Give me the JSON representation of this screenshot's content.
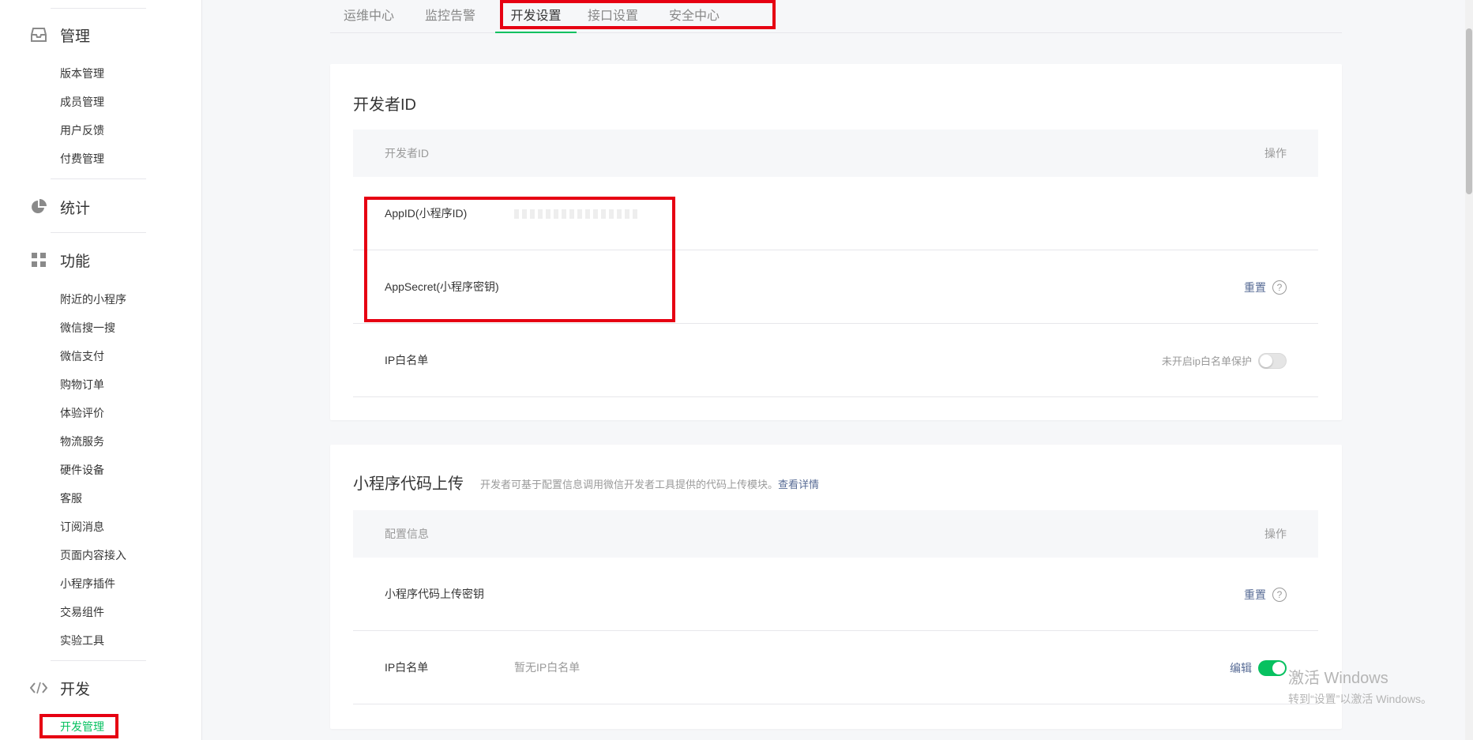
{
  "sidebar": {
    "sections": [
      {
        "label": "管理",
        "icon": "inbox-icon"
      },
      {
        "label": "统计",
        "icon": "pie-chart-icon"
      },
      {
        "label": "功能",
        "icon": "grid-icon"
      },
      {
        "label": "开发",
        "icon": "code-icon"
      }
    ],
    "manage_items": [
      "版本管理",
      "成员管理",
      "用户反馈",
      "付费管理"
    ],
    "feature_items": [
      "附近的小程序",
      "微信搜一搜",
      "微信支付",
      "购物订单",
      "体验评价",
      "物流服务",
      "硬件设备",
      "客服",
      "订阅消息",
      "页面内容接入",
      "小程序插件",
      "交易组件",
      "实验工具"
    ],
    "dev_items": [
      "开发管理"
    ]
  },
  "tabs": [
    "运维中心",
    "监控告警",
    "开发设置",
    "接口设置",
    "安全中心"
  ],
  "active_tab": "开发设置",
  "dev_id_card": {
    "title": "开发者ID",
    "col_name": "开发者ID",
    "col_ops": "操作",
    "rows": [
      {
        "name": "AppID(小程序ID)",
        "value": ""
      },
      {
        "name": "AppSecret(小程序密钥)",
        "op_link": "重置"
      },
      {
        "name": "IP白名单",
        "op_text": "未开启ip白名单保护"
      }
    ]
  },
  "upload_card": {
    "title": "小程序代码上传",
    "desc": "开发者可基于配置信息调用微信开发者工具提供的代码上传模块。",
    "desc_link": "查看详情",
    "col_name": "配置信息",
    "col_ops": "操作",
    "rows": [
      {
        "name": "小程序代码上传密钥",
        "op_link": "重置"
      },
      {
        "name": "IP白名单",
        "value": "暂无IP白名单",
        "op_link": "编辑"
      }
    ]
  },
  "watermark": {
    "line1": "激活 Windows",
    "line2": "转到“设置”以激活 Windows。"
  },
  "colors": {
    "accent": "#07c160",
    "link": "#576b95",
    "highlight": "#e60012"
  }
}
